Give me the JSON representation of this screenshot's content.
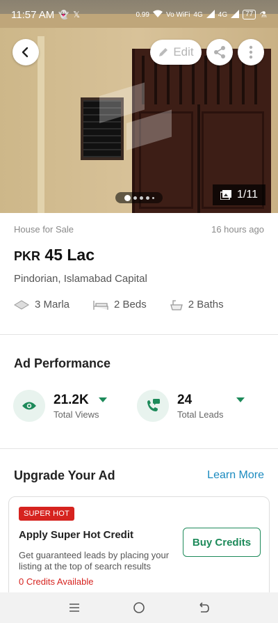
{
  "status_bar": {
    "time": "11:57 AM",
    "net_speed": "0.99",
    "net_unit": "K/S",
    "volte": "Vo WiFi",
    "net1": "4G",
    "net2": "4G",
    "battery": "77"
  },
  "hero": {
    "edit_label": "Edit",
    "image_counter": "1/11",
    "back_icon": "back-arrow-icon",
    "share_icon": "share-icon",
    "more_icon": "more-vert-icon"
  },
  "listing": {
    "type": "House for Sale",
    "posted": "16 hours ago",
    "currency": "PKR",
    "price": "45 Lac",
    "location": "Pindorian, Islamabad Capital",
    "specs": [
      {
        "icon": "area-icon",
        "label": "3 Marla"
      },
      {
        "icon": "bed-icon",
        "label": "2 Beds"
      },
      {
        "icon": "bath-icon",
        "label": "2 Baths"
      }
    ]
  },
  "performance": {
    "title": "Ad Performance",
    "views": {
      "value": "21.2K",
      "label": "Total Views",
      "icon": "eye-icon"
    },
    "leads": {
      "value": "24",
      "label": "Total Leads",
      "icon": "phone-chat-icon"
    }
  },
  "upgrade": {
    "title": "Upgrade Your Ad",
    "learn_more": "Learn More",
    "card": {
      "badge": "SUPER HOT",
      "title": "Apply Super Hot Credit",
      "description": "Get guaranteed leads by placing your listing at the top of search results",
      "credits": "0 Credits Available",
      "button": "Buy Credits"
    }
  },
  "colors": {
    "accent_green": "#1d8a5a",
    "link_blue": "#1a8abf",
    "badge_red": "#d6231f"
  }
}
